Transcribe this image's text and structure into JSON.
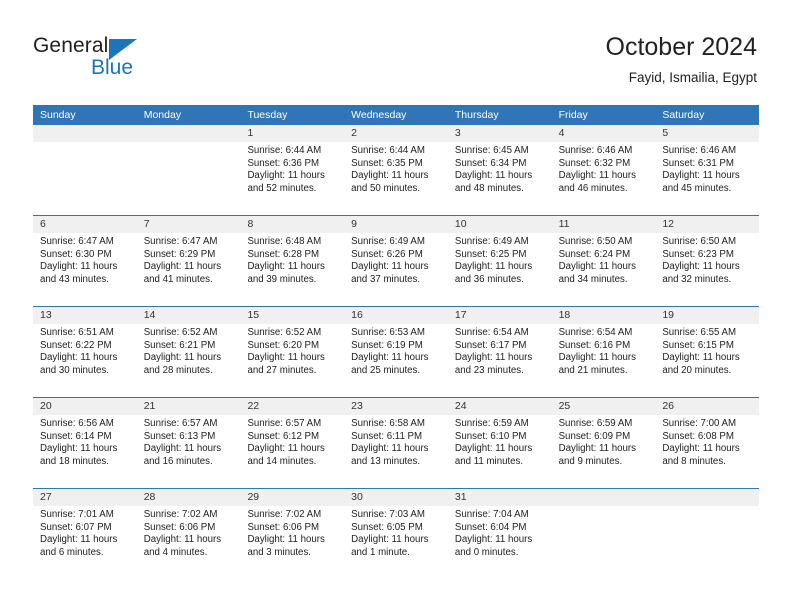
{
  "logo": {
    "word_one": "General",
    "word_two": "Blue",
    "triangle_color": "#1b75bb"
  },
  "header": {
    "title": "October 2024",
    "subtitle": "Fayid, Ismailia, Egypt"
  },
  "theme": {
    "header_blue": "#3075b5",
    "band_gray": "#f0f0f0",
    "text": "#222222"
  },
  "calendar": {
    "day_names": [
      "Sunday",
      "Monday",
      "Tuesday",
      "Wednesday",
      "Thursday",
      "Friday",
      "Saturday"
    ],
    "weeks": [
      [
        {
          "day": "",
          "sunrise": "",
          "sunset": "",
          "daylight_line1": "",
          "daylight_line2": ""
        },
        {
          "day": "",
          "sunrise": "",
          "sunset": "",
          "daylight_line1": "",
          "daylight_line2": ""
        },
        {
          "day": "1",
          "sunrise": "Sunrise: 6:44 AM",
          "sunset": "Sunset: 6:36 PM",
          "daylight_line1": "Daylight: 11 hours",
          "daylight_line2": "and 52 minutes."
        },
        {
          "day": "2",
          "sunrise": "Sunrise: 6:44 AM",
          "sunset": "Sunset: 6:35 PM",
          "daylight_line1": "Daylight: 11 hours",
          "daylight_line2": "and 50 minutes."
        },
        {
          "day": "3",
          "sunrise": "Sunrise: 6:45 AM",
          "sunset": "Sunset: 6:34 PM",
          "daylight_line1": "Daylight: 11 hours",
          "daylight_line2": "and 48 minutes."
        },
        {
          "day": "4",
          "sunrise": "Sunrise: 6:46 AM",
          "sunset": "Sunset: 6:32 PM",
          "daylight_line1": "Daylight: 11 hours",
          "daylight_line2": "and 46 minutes."
        },
        {
          "day": "5",
          "sunrise": "Sunrise: 6:46 AM",
          "sunset": "Sunset: 6:31 PM",
          "daylight_line1": "Daylight: 11 hours",
          "daylight_line2": "and 45 minutes."
        }
      ],
      [
        {
          "day": "6",
          "sunrise": "Sunrise: 6:47 AM",
          "sunset": "Sunset: 6:30 PM",
          "daylight_line1": "Daylight: 11 hours",
          "daylight_line2": "and 43 minutes."
        },
        {
          "day": "7",
          "sunrise": "Sunrise: 6:47 AM",
          "sunset": "Sunset: 6:29 PM",
          "daylight_line1": "Daylight: 11 hours",
          "daylight_line2": "and 41 minutes."
        },
        {
          "day": "8",
          "sunrise": "Sunrise: 6:48 AM",
          "sunset": "Sunset: 6:28 PM",
          "daylight_line1": "Daylight: 11 hours",
          "daylight_line2": "and 39 minutes."
        },
        {
          "day": "9",
          "sunrise": "Sunrise: 6:49 AM",
          "sunset": "Sunset: 6:26 PM",
          "daylight_line1": "Daylight: 11 hours",
          "daylight_line2": "and 37 minutes."
        },
        {
          "day": "10",
          "sunrise": "Sunrise: 6:49 AM",
          "sunset": "Sunset: 6:25 PM",
          "daylight_line1": "Daylight: 11 hours",
          "daylight_line2": "and 36 minutes."
        },
        {
          "day": "11",
          "sunrise": "Sunrise: 6:50 AM",
          "sunset": "Sunset: 6:24 PM",
          "daylight_line1": "Daylight: 11 hours",
          "daylight_line2": "and 34 minutes."
        },
        {
          "day": "12",
          "sunrise": "Sunrise: 6:50 AM",
          "sunset": "Sunset: 6:23 PM",
          "daylight_line1": "Daylight: 11 hours",
          "daylight_line2": "and 32 minutes."
        }
      ],
      [
        {
          "day": "13",
          "sunrise": "Sunrise: 6:51 AM",
          "sunset": "Sunset: 6:22 PM",
          "daylight_line1": "Daylight: 11 hours",
          "daylight_line2": "and 30 minutes."
        },
        {
          "day": "14",
          "sunrise": "Sunrise: 6:52 AM",
          "sunset": "Sunset: 6:21 PM",
          "daylight_line1": "Daylight: 11 hours",
          "daylight_line2": "and 28 minutes."
        },
        {
          "day": "15",
          "sunrise": "Sunrise: 6:52 AM",
          "sunset": "Sunset: 6:20 PM",
          "daylight_line1": "Daylight: 11 hours",
          "daylight_line2": "and 27 minutes."
        },
        {
          "day": "16",
          "sunrise": "Sunrise: 6:53 AM",
          "sunset": "Sunset: 6:19 PM",
          "daylight_line1": "Daylight: 11 hours",
          "daylight_line2": "and 25 minutes."
        },
        {
          "day": "17",
          "sunrise": "Sunrise: 6:54 AM",
          "sunset": "Sunset: 6:17 PM",
          "daylight_line1": "Daylight: 11 hours",
          "daylight_line2": "and 23 minutes."
        },
        {
          "day": "18",
          "sunrise": "Sunrise: 6:54 AM",
          "sunset": "Sunset: 6:16 PM",
          "daylight_line1": "Daylight: 11 hours",
          "daylight_line2": "and 21 minutes."
        },
        {
          "day": "19",
          "sunrise": "Sunrise: 6:55 AM",
          "sunset": "Sunset: 6:15 PM",
          "daylight_line1": "Daylight: 11 hours",
          "daylight_line2": "and 20 minutes."
        }
      ],
      [
        {
          "day": "20",
          "sunrise": "Sunrise: 6:56 AM",
          "sunset": "Sunset: 6:14 PM",
          "daylight_line1": "Daylight: 11 hours",
          "daylight_line2": "and 18 minutes."
        },
        {
          "day": "21",
          "sunrise": "Sunrise: 6:57 AM",
          "sunset": "Sunset: 6:13 PM",
          "daylight_line1": "Daylight: 11 hours",
          "daylight_line2": "and 16 minutes."
        },
        {
          "day": "22",
          "sunrise": "Sunrise: 6:57 AM",
          "sunset": "Sunset: 6:12 PM",
          "daylight_line1": "Daylight: 11 hours",
          "daylight_line2": "and 14 minutes."
        },
        {
          "day": "23",
          "sunrise": "Sunrise: 6:58 AM",
          "sunset": "Sunset: 6:11 PM",
          "daylight_line1": "Daylight: 11 hours",
          "daylight_line2": "and 13 minutes."
        },
        {
          "day": "24",
          "sunrise": "Sunrise: 6:59 AM",
          "sunset": "Sunset: 6:10 PM",
          "daylight_line1": "Daylight: 11 hours",
          "daylight_line2": "and 11 minutes."
        },
        {
          "day": "25",
          "sunrise": "Sunrise: 6:59 AM",
          "sunset": "Sunset: 6:09 PM",
          "daylight_line1": "Daylight: 11 hours",
          "daylight_line2": "and 9 minutes."
        },
        {
          "day": "26",
          "sunrise": "Sunrise: 7:00 AM",
          "sunset": "Sunset: 6:08 PM",
          "daylight_line1": "Daylight: 11 hours",
          "daylight_line2": "and 8 minutes."
        }
      ],
      [
        {
          "day": "27",
          "sunrise": "Sunrise: 7:01 AM",
          "sunset": "Sunset: 6:07 PM",
          "daylight_line1": "Daylight: 11 hours",
          "daylight_line2": "and 6 minutes."
        },
        {
          "day": "28",
          "sunrise": "Sunrise: 7:02 AM",
          "sunset": "Sunset: 6:06 PM",
          "daylight_line1": "Daylight: 11 hours",
          "daylight_line2": "and 4 minutes."
        },
        {
          "day": "29",
          "sunrise": "Sunrise: 7:02 AM",
          "sunset": "Sunset: 6:06 PM",
          "daylight_line1": "Daylight: 11 hours",
          "daylight_line2": "and 3 minutes."
        },
        {
          "day": "30",
          "sunrise": "Sunrise: 7:03 AM",
          "sunset": "Sunset: 6:05 PM",
          "daylight_line1": "Daylight: 11 hours",
          "daylight_line2": "and 1 minute."
        },
        {
          "day": "31",
          "sunrise": "Sunrise: 7:04 AM",
          "sunset": "Sunset: 6:04 PM",
          "daylight_line1": "Daylight: 11 hours",
          "daylight_line2": "and 0 minutes."
        },
        {
          "day": "",
          "sunrise": "",
          "sunset": "",
          "daylight_line1": "",
          "daylight_line2": ""
        },
        {
          "day": "",
          "sunrise": "",
          "sunset": "",
          "daylight_line1": "",
          "daylight_line2": ""
        }
      ]
    ]
  }
}
